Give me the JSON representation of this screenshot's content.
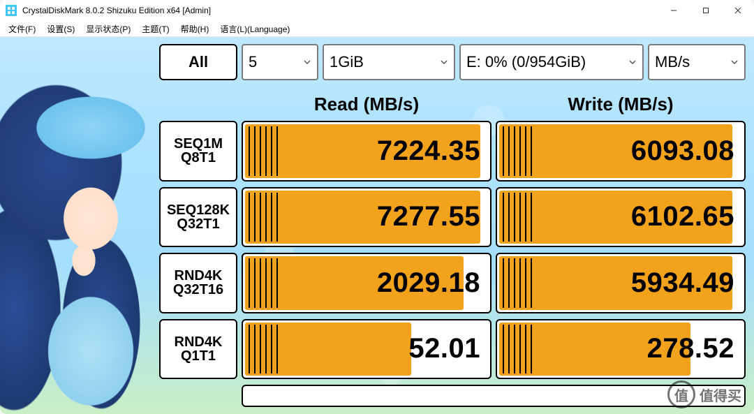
{
  "window": {
    "title": "CrystalDiskMark 8.0.2 Shizuku Edition x64 [Admin]"
  },
  "menu": {
    "file": "文件(F)",
    "settings": "设置(S)",
    "display": "显示状态(P)",
    "theme": "主题(T)",
    "help": "帮助(H)",
    "language": "语言(L)(Language)"
  },
  "toolbar": {
    "all": "All"
  },
  "combos": {
    "count": "5",
    "size": "1GiB",
    "drive": "E: 0% (0/954GiB)",
    "unit": "MB/s"
  },
  "headers": {
    "read": "Read (MB/s)",
    "write": "Write (MB/s)"
  },
  "tests": [
    {
      "name1": "SEQ1M",
      "name2": "Q8T1",
      "read": "7224.35",
      "write": "6093.08",
      "read_bar": 0.97,
      "write_bar": 0.96
    },
    {
      "name1": "SEQ128K",
      "name2": "Q32T1",
      "read": "7277.55",
      "write": "6102.65",
      "read_bar": 0.97,
      "write_bar": 0.96
    },
    {
      "name1": "RND4K",
      "name2": "Q32T16",
      "read": "2029.18",
      "write": "5934.49",
      "read_bar": 0.9,
      "write_bar": 0.96
    },
    {
      "name1": "RND4K",
      "name2": "Q1T1",
      "read": "52.01",
      "write": "278.52",
      "read_bar": 0.69,
      "write_bar": 0.79
    }
  ],
  "watermark": {
    "char": "值",
    "text": "值得买"
  },
  "chart_data": {
    "type": "table",
    "title": "CrystalDiskMark 8.0.2 Shizuku Edition x64 — E: 0% (0/954GiB), 5× 1GiB, MB/s",
    "columns": [
      "Test",
      "Read (MB/s)",
      "Write (MB/s)"
    ],
    "rows": [
      [
        "SEQ1M Q8T1",
        7224.35,
        6093.08
      ],
      [
        "SEQ128K Q32T1",
        7277.55,
        6102.65
      ],
      [
        "RND4K Q32T16",
        2029.18,
        5934.49
      ],
      [
        "RND4K Q1T1",
        52.01,
        278.52
      ]
    ]
  }
}
